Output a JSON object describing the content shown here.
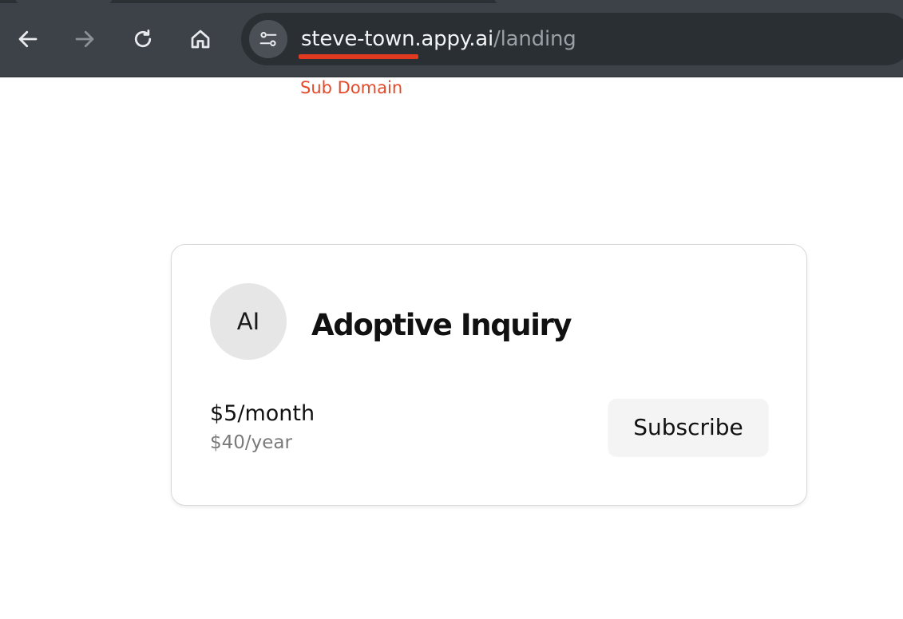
{
  "browser": {
    "url_host": "steve-town.appy.ai",
    "url_path": "/landing",
    "icons": {
      "back": "back-arrow-icon",
      "forward": "forward-arrow-icon",
      "reload": "reload-icon",
      "home": "home-icon",
      "site_info": "tune-icon"
    }
  },
  "annotation": {
    "label": "Sub Domain",
    "color": "#e44a2a"
  },
  "card": {
    "avatar_initials": "AI",
    "title": "Adoptive Inquiry",
    "price_monthly": "$5/month",
    "price_yearly": "$40/year",
    "subscribe_label": "Subscribe"
  }
}
